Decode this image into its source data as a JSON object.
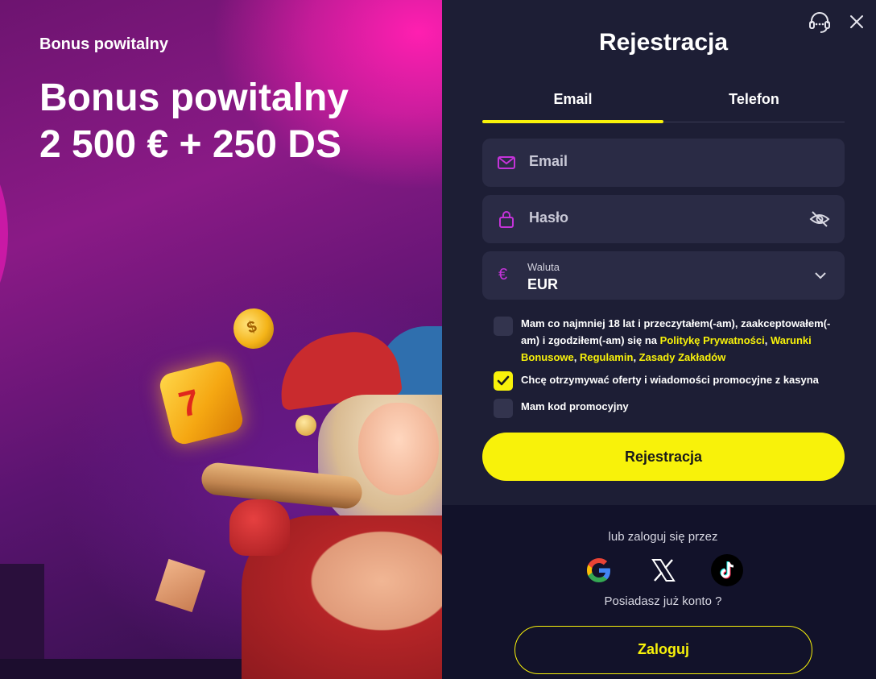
{
  "promo": {
    "small_title": "Bonus powitalny",
    "big_title_line1": "Bonus powitalny",
    "big_title_line2": "2 500 € + 250 DS"
  },
  "modal": {
    "title": "Rejestracja",
    "tabs": [
      {
        "label": "Email",
        "active": true
      },
      {
        "label": "Telefon",
        "active": false
      }
    ],
    "email": {
      "placeholder": "Email",
      "icon": "mail-icon"
    },
    "password": {
      "placeholder": "Hasło",
      "icon": "lock-icon",
      "toggle_icon": "eye-off-icon"
    },
    "currency": {
      "label": "Waluta",
      "value": "EUR",
      "symbol": "€"
    },
    "checkboxes": {
      "terms": {
        "checked": false,
        "text_part1": "Mam co najmniej 18 lat i przeczytałem(-am), zaakceptowałem(-am) i zgodziłem(-am) się na ",
        "link_privacy": "Politykę Prywatności",
        "sep1": ", ",
        "link_bonus": "Warunki Bonusowe",
        "sep2": ", ",
        "link_rules": "Regulamin",
        "sep3": ", ",
        "link_betting": "Zasady Zakładów"
      },
      "marketing": {
        "checked": true,
        "text": "Chcę otrzymywać oferty i wiadomości promocyjne z kasyna"
      },
      "promo_code": {
        "checked": false,
        "text": "Mam kod promocyjny"
      }
    },
    "register_button": "Rejestracja",
    "or_login_with": "lub zaloguj się przez",
    "social": [
      "google-icon",
      "x-icon",
      "tiktok-icon"
    ],
    "have_account": "Posiadasz już konto ?",
    "login_button": "Zaloguj"
  },
  "colors": {
    "accent": "#f8f20a",
    "panel_bg": "#1d1e35",
    "field_bg": "#2a2b45",
    "icon_magenta": "#c433d9"
  }
}
